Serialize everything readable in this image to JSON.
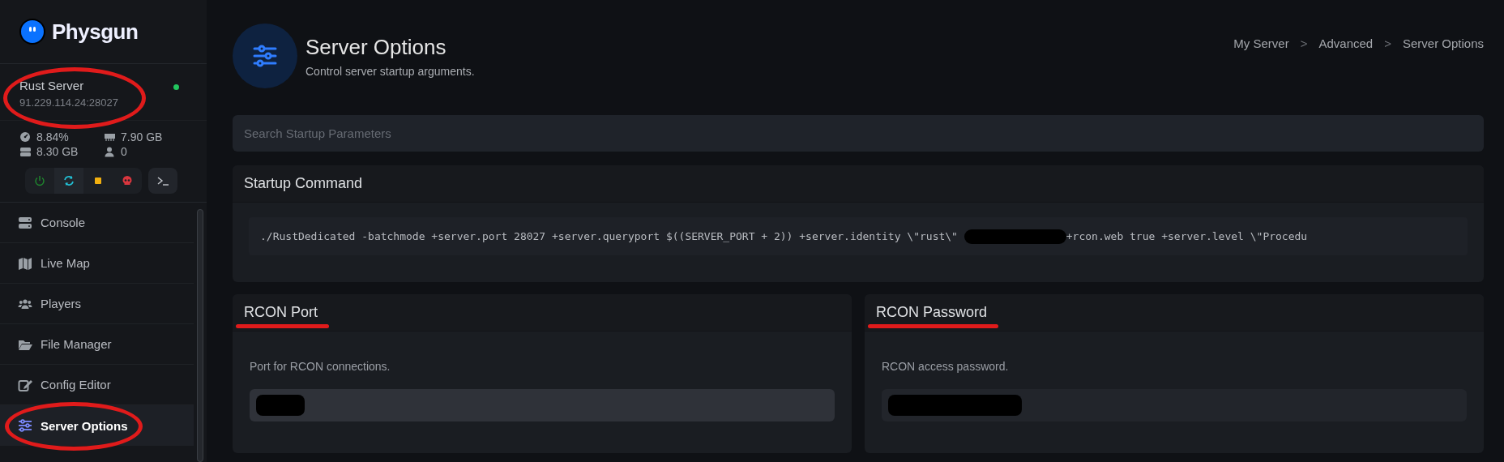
{
  "brand": {
    "name": "Physgun"
  },
  "server": {
    "name": "Rust Server",
    "address": "91.229.114.24:28027",
    "online": true,
    "circled": true
  },
  "stats": [
    {
      "value": "8.84%"
    },
    {
      "value": "7.90 GB"
    },
    {
      "value": "8.30 GB"
    },
    {
      "value": "0"
    }
  ],
  "nav": [
    {
      "label": "Console",
      "selected": false,
      "circled": false
    },
    {
      "label": "Live Map",
      "selected": false,
      "circled": false
    },
    {
      "label": "Players",
      "selected": false,
      "circled": false
    },
    {
      "label": "File Manager",
      "selected": false,
      "circled": false
    },
    {
      "label": "Config Editor",
      "selected": false,
      "circled": false
    },
    {
      "label": "Server Options",
      "selected": true,
      "circled": true
    }
  ],
  "page": {
    "title": "Server Options",
    "subtitle": "Control server startup arguments."
  },
  "breadcrumb": {
    "items": [
      "My Server",
      "Advanced",
      "Server Options"
    ],
    "separators": [
      ">",
      ">"
    ]
  },
  "search": {
    "placeholder": "Search Startup Parameters"
  },
  "startup": {
    "title": "Startup Command",
    "segments": [
      {
        "kind": "text",
        "text": "./RustDedicated -batchmode +server.port 28027 +server.queryport $((SERVER_PORT + 2)) +server.identity \\\"rust\\\" "
      },
      {
        "kind": "redacted"
      },
      {
        "kind": "text",
        "text": "+rcon.web true +server.level \\\"Procedu"
      }
    ]
  },
  "options": [
    {
      "title": "RCON Port",
      "underlined": true,
      "description": "Port for RCON connections.",
      "redacted": true,
      "hovered": true
    },
    {
      "title": "RCON Password",
      "underlined": true,
      "description": "RCON access password.",
      "redacted": true,
      "hovered": false
    }
  ]
}
